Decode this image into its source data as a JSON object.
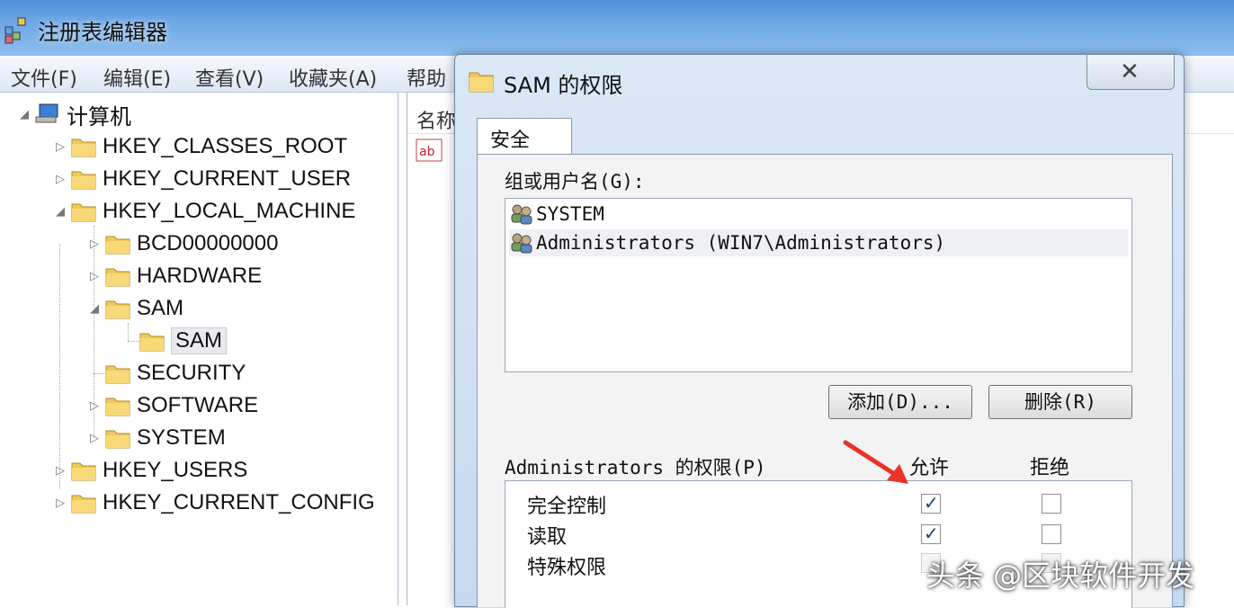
{
  "window": {
    "title": "注册表编辑器"
  },
  "menu": [
    "文件(F)",
    "编辑(E)",
    "查看(V)",
    "收藏夹(A)",
    "帮助"
  ],
  "tree": {
    "root": "计算机",
    "items": [
      "HKEY_CLASSES_ROOT",
      "HKEY_CURRENT_USER",
      "HKEY_LOCAL_MACHINE",
      "BCD00000000",
      "HARDWARE",
      "SAM",
      "SAM",
      "SECURITY",
      "SOFTWARE",
      "SYSTEM",
      "HKEY_USERS",
      "HKEY_CURRENT_CONFIG"
    ]
  },
  "right_pane": {
    "column_header": "名称"
  },
  "dialog": {
    "title": "SAM 的权限",
    "tab": "安全",
    "users_label": "组或用户名(G):",
    "users": [
      "SYSTEM",
      "Administrators (WIN7\\Administrators)"
    ],
    "add_button": "添加(D)...",
    "remove_button": "删除(R)",
    "permissions_label": "Administrators 的权限(P)",
    "allow_header": "允许",
    "deny_header": "拒绝",
    "permissions": [
      {
        "name": "完全控制",
        "allow": true,
        "deny": false
      },
      {
        "name": "读取",
        "allow": true,
        "deny": false
      },
      {
        "name": "特殊权限",
        "allow": false,
        "deny": false
      }
    ]
  },
  "watermark": "头条 @区块软件开发",
  "colors": {
    "titlebar": "#6aa5e4",
    "arrow": "#e8322a",
    "selection": "#e8eaee"
  }
}
